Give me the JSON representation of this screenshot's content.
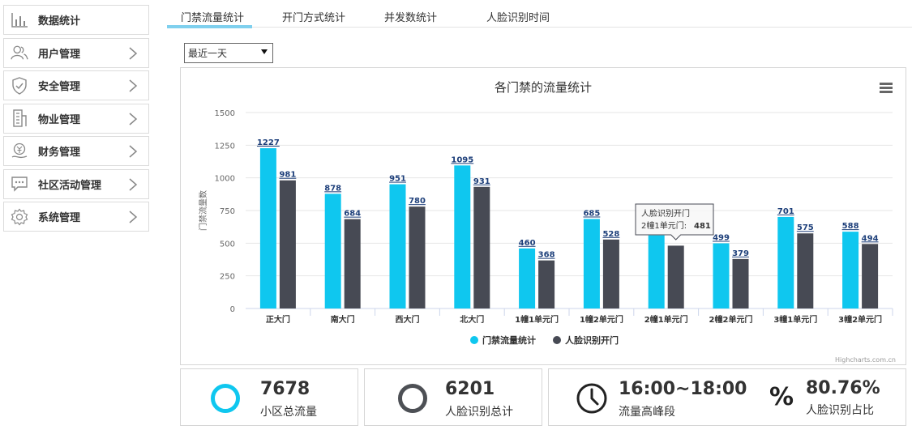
{
  "sidebar": {
    "items": [
      {
        "label": "数据统计",
        "icon": "bar-chart-icon",
        "chevron": false
      },
      {
        "label": "用户管理",
        "icon": "users-icon",
        "chevron": true
      },
      {
        "label": "安全管理",
        "icon": "shield-icon",
        "chevron": true
      },
      {
        "label": "物业管理",
        "icon": "building-icon",
        "chevron": true
      },
      {
        "label": "财务管理",
        "icon": "money-hand-icon",
        "chevron": true
      },
      {
        "label": "社区活动管理",
        "icon": "message-icon",
        "chevron": true
      },
      {
        "label": "系统管理",
        "icon": "gear-icon",
        "chevron": true
      }
    ]
  },
  "tabs": [
    {
      "label": "门禁流量统计",
      "active": true
    },
    {
      "label": "开门方式统计",
      "active": false
    },
    {
      "label": "并发数统计",
      "active": false
    },
    {
      "label": "人脸识别时间",
      "active": false
    }
  ],
  "filter": {
    "selected": "最近一天"
  },
  "chart_data": {
    "type": "bar",
    "title": "各门禁的流量统计",
    "xlabel": "",
    "ylabel": "门禁流量数",
    "ylim": [
      0,
      1500
    ],
    "yticks": [
      0,
      250,
      500,
      750,
      1000,
      1250,
      1500
    ],
    "categories": [
      "正大门",
      "南大门",
      "西大门",
      "北大门",
      "1幢1单元门",
      "1幢2单元门",
      "2幢1单元门",
      "2幢2单元门",
      "3幢1单元门",
      "3幢2单元门"
    ],
    "series": [
      {
        "name": "门禁流量统计",
        "color": "#0fc7ef",
        "values": [
          1227,
          878,
          951,
          1095,
          460,
          685,
          560,
          499,
          701,
          588
        ],
        "labels": [
          "1227",
          "878",
          "951",
          "1095",
          "460",
          "685",
          "",
          "499",
          "701",
          "588"
        ]
      },
      {
        "name": "人脸识别开门",
        "color": "#474a54",
        "values": [
          981,
          684,
          780,
          931,
          368,
          528,
          481,
          379,
          575,
          494
        ],
        "labels": [
          "981",
          "684",
          "780",
          "931",
          "368",
          "528",
          "",
          "379",
          "575",
          "494"
        ]
      }
    ],
    "grid": true,
    "legend": "bottom-center",
    "tooltip": {
      "series": "人脸识别开门",
      "category": "2幢1单元门",
      "value": "481"
    },
    "credits": "Highcharts.com.cn"
  },
  "stats": [
    {
      "value": "7678",
      "label": "小区总流量",
      "icon": "ring-icon",
      "color": "#0fc7ef"
    },
    {
      "value": "6201",
      "label": "人脸识别总计",
      "icon": "ring-icon",
      "color": "#4d5055"
    },
    {
      "value": "16:00~18:00",
      "label": "流量高峰段",
      "icon": "clock-icon"
    },
    {
      "value": "80.76%",
      "label": "人脸识别占比",
      "icon": "percent-icon"
    }
  ]
}
